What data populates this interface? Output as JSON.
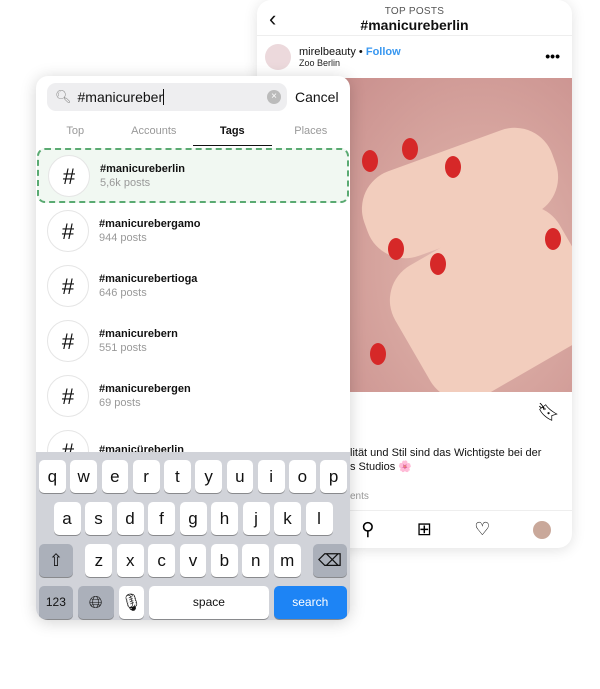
{
  "post_view": {
    "header_sub": "TOP POSTS",
    "header_title": "#manicureberlin",
    "username": "mirelbeauty",
    "separator": "•",
    "follow": "Follow",
    "location": "Zoo Berlin",
    "more": "•••",
    "caption_line1": "lität und Stil sind das Wichtigste bei der",
    "caption_line2": "s Studios 🌸",
    "comments": "ents"
  },
  "search": {
    "value": "#manicureber",
    "cancel": "Cancel",
    "tabs": [
      {
        "label": "Top"
      },
      {
        "label": "Accounts"
      },
      {
        "label": "Tags"
      },
      {
        "label": "Places"
      }
    ]
  },
  "results": [
    {
      "name": "#manicureberlin",
      "count": "5,6k posts"
    },
    {
      "name": "#manicurebergamo",
      "count": "944 posts"
    },
    {
      "name": "#manicurebertioga",
      "count": "646 posts"
    },
    {
      "name": "#manicurebern",
      "count": "551 posts"
    },
    {
      "name": "#manicurebergen",
      "count": "69 posts"
    },
    {
      "name": "#manicüreberlin",
      "count": ""
    }
  ],
  "keyboard": {
    "row1": [
      "q",
      "w",
      "e",
      "r",
      "t",
      "y",
      "u",
      "i",
      "o",
      "p"
    ],
    "row2": [
      "a",
      "s",
      "d",
      "f",
      "g",
      "h",
      "j",
      "k",
      "l"
    ],
    "row3": [
      "z",
      "x",
      "c",
      "v",
      "b",
      "n",
      "m"
    ],
    "numbers": "123",
    "space": "space",
    "search": "search"
  },
  "colors": {
    "highlight": "#5aaa72",
    "follow": "#3897f0",
    "search_key": "#1d84f5"
  }
}
